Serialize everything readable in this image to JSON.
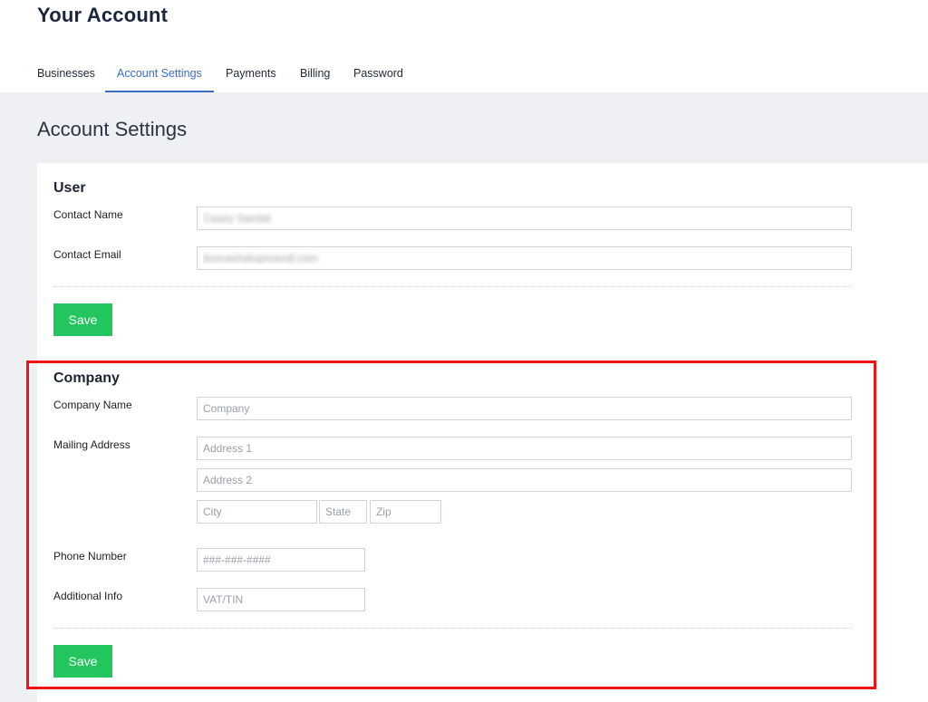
{
  "header": {
    "title": "Your Account"
  },
  "tabs": [
    {
      "label": "Businesses",
      "active": false
    },
    {
      "label": "Account Settings",
      "active": true
    },
    {
      "label": "Payments",
      "active": false
    },
    {
      "label": "Billing",
      "active": false
    },
    {
      "label": "Password",
      "active": false
    }
  ],
  "main": {
    "heading": "Account Settings"
  },
  "user_section": {
    "title": "User",
    "contact_name_label": "Contact Name",
    "contact_name_value": "Casey Sandal",
    "contact_email_label": "Contact Email",
    "contact_email_value": "boxcashalupnrandl.com",
    "save_label": "Save"
  },
  "company_section": {
    "title": "Company",
    "company_name_label": "Company Name",
    "company_name_placeholder": "Company",
    "mailing_address_label": "Mailing Address",
    "address1_placeholder": "Address 1",
    "address2_placeholder": "Address 2",
    "city_placeholder": "City",
    "state_placeholder": "State",
    "zip_placeholder": "Zip",
    "phone_label": "Phone Number",
    "phone_placeholder": "###-###-####",
    "additional_info_label": "Additional Info",
    "additional_info_placeholder": "VAT/TIN",
    "save_label": "Save"
  },
  "colors": {
    "accent": "#3b6cc9",
    "save_button": "#22c55e",
    "highlight_border": "#f01414",
    "content_background": "#eef0f3"
  }
}
